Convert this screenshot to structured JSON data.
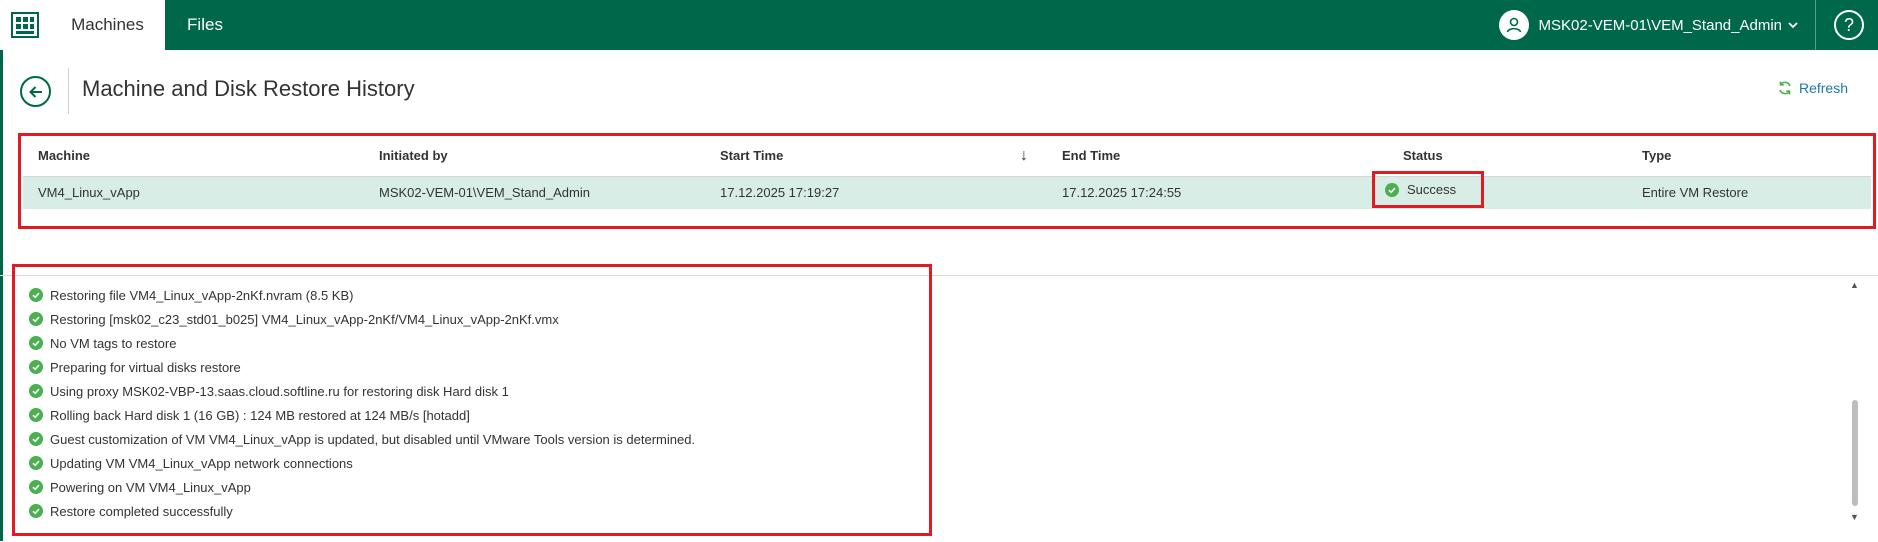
{
  "topbar": {
    "tabs": [
      {
        "label": "Machines",
        "active": true
      },
      {
        "label": "Files",
        "active": false
      }
    ],
    "user": "MSK02-VEM-01\\VEM_Stand_Admin",
    "help_label": "?"
  },
  "header": {
    "title": "Machine and Disk Restore History",
    "refresh_label": "Refresh"
  },
  "table": {
    "columns": [
      "Machine",
      "Initiated by",
      "Start Time",
      "End Time",
      "Status",
      "Type"
    ],
    "sort_indicator": "↓",
    "rows": [
      {
        "machine": "VM4_Linux_vApp",
        "initiated_by": "MSK02-VEM-01\\VEM_Stand_Admin",
        "start_time": "17.12.2025 17:19:27",
        "end_time": "17.12.2025 17:24:55",
        "status": "Success",
        "type": "Entire VM Restore"
      }
    ]
  },
  "log": {
    "entries": [
      "Restoring file VM4_Linux_vApp-2nKf.nvram (8.5 KB)",
      "Restoring [msk02_c23_std01_b025] VM4_Linux_vApp-2nKf/VM4_Linux_vApp-2nKf.vmx",
      "No VM tags to restore",
      "Preparing for virtual disks restore",
      "Using proxy MSK02-VBP-13.saas.cloud.softline.ru for restoring disk Hard disk 1",
      "Rolling back Hard disk 1 (16 GB) : 124 MB restored at 124 MB/s [hotadd]",
      "Guest customization of VM VM4_Linux_vApp is updated, but disabled until VMware Tools version is determined.",
      "Updating VM VM4_Linux_vApp network connections",
      "Powering on VM VM4_Linux_vApp",
      "Restore completed successfully"
    ]
  },
  "colors": {
    "brand_green": "#00684a",
    "selected_row": "#d7ede5",
    "success_green": "#4caf50",
    "highlight_red": "#e01b24",
    "link_blue": "#1d78a8"
  },
  "icons": {
    "logo": "veeam-app-icon",
    "avatar": "user-icon",
    "back": "arrow-left-icon",
    "refresh": "refresh-icon",
    "status": "check-circle-icon"
  }
}
